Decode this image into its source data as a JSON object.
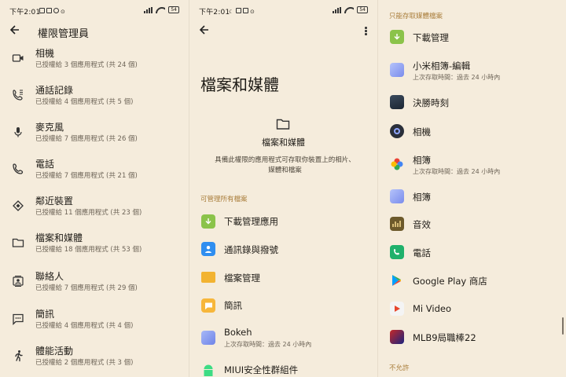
{
  "status_bar": {
    "time": "下午2:01",
    "battery": "54"
  },
  "pane1": {
    "title": "權限管理員",
    "items": [
      {
        "label": "相機",
        "sub": "已授權給 3 個應用程式 (共 24 個)",
        "icon": "camera-icon"
      },
      {
        "label": "通話記錄",
        "sub": "已授權給 4 個應用程式 (共 5 個)",
        "icon": "call-log-icon"
      },
      {
        "label": "麥克風",
        "sub": "已授權給 7 個應用程式 (共 26 個)",
        "icon": "microphone-icon"
      },
      {
        "label": "電話",
        "sub": "已授權給 7 個應用程式 (共 21 個)",
        "icon": "phone-icon"
      },
      {
        "label": "鄰近裝置",
        "sub": "已授權給 11 個應用程式 (共 23 個)",
        "icon": "nearby-devices-icon"
      },
      {
        "label": "檔案和媒體",
        "sub": "已授權給 18 個應用程式 (共 53 個)",
        "icon": "folder-icon"
      },
      {
        "label": "聯絡人",
        "sub": "已授權給 7 個應用程式 (共 29 個)",
        "icon": "contacts-icon"
      },
      {
        "label": "簡訊",
        "sub": "已授權給 4 個應用程式 (共 4 個)",
        "icon": "sms-icon"
      },
      {
        "label": "體能活動",
        "sub": "已授權給 2 個應用程式 (共 3 個)",
        "icon": "activity-icon"
      }
    ]
  },
  "pane2": {
    "title": "檔案和媒體",
    "hero_label": "檔案和媒體",
    "hero_description": "具備此權限的應用程式可存取你裝置上的相片、媒體和檔案",
    "section_all_files": "可管理所有檔案",
    "apps": [
      {
        "label": "下載管理應用",
        "sub": "",
        "icon": "download-icon"
      },
      {
        "label": "通訊錄與撥號",
        "sub": "",
        "icon": "contacts-app-icon"
      },
      {
        "label": "檔案管理",
        "sub": "",
        "icon": "file-manager-icon"
      },
      {
        "label": "簡訊",
        "sub": "",
        "icon": "messages-app-icon"
      },
      {
        "label": "Bokeh",
        "sub": "上次存取時間：過去 24 小時內",
        "icon": "bokeh-icon"
      },
      {
        "label": "MIUI安全性群組件",
        "sub": "",
        "icon": "android-icon"
      }
    ]
  },
  "pane3": {
    "section_media_only": "只能存取媒體檔案",
    "section_not_allowed": "不允許",
    "apps": [
      {
        "label": "下載管理",
        "sub": "",
        "icon": "download-icon"
      },
      {
        "label": "小米相簿-編輯",
        "sub": "上次存取時間：過去 24 小時內",
        "icon": "gallery-editor-icon"
      },
      {
        "label": "決勝時刻",
        "sub": "",
        "icon": "game-icon"
      },
      {
        "label": "相機",
        "sub": "",
        "icon": "camera-app-icon"
      },
      {
        "label": "相簿",
        "sub": "上次存取時間：過去 24 小時內",
        "icon": "google-photos-icon"
      },
      {
        "label": "相簿",
        "sub": "",
        "icon": "gallery-icon"
      },
      {
        "label": "音效",
        "sub": "",
        "icon": "sound-icon"
      },
      {
        "label": "電話",
        "sub": "",
        "icon": "phone-app-icon"
      },
      {
        "label": "Google Play 商店",
        "sub": "",
        "icon": "play-store-icon"
      },
      {
        "label": "Mi Video",
        "sub": "",
        "icon": "mi-video-icon"
      },
      {
        "label": "MLB9局職棒22",
        "sub": "",
        "icon": "baseball-game-icon"
      }
    ]
  }
}
